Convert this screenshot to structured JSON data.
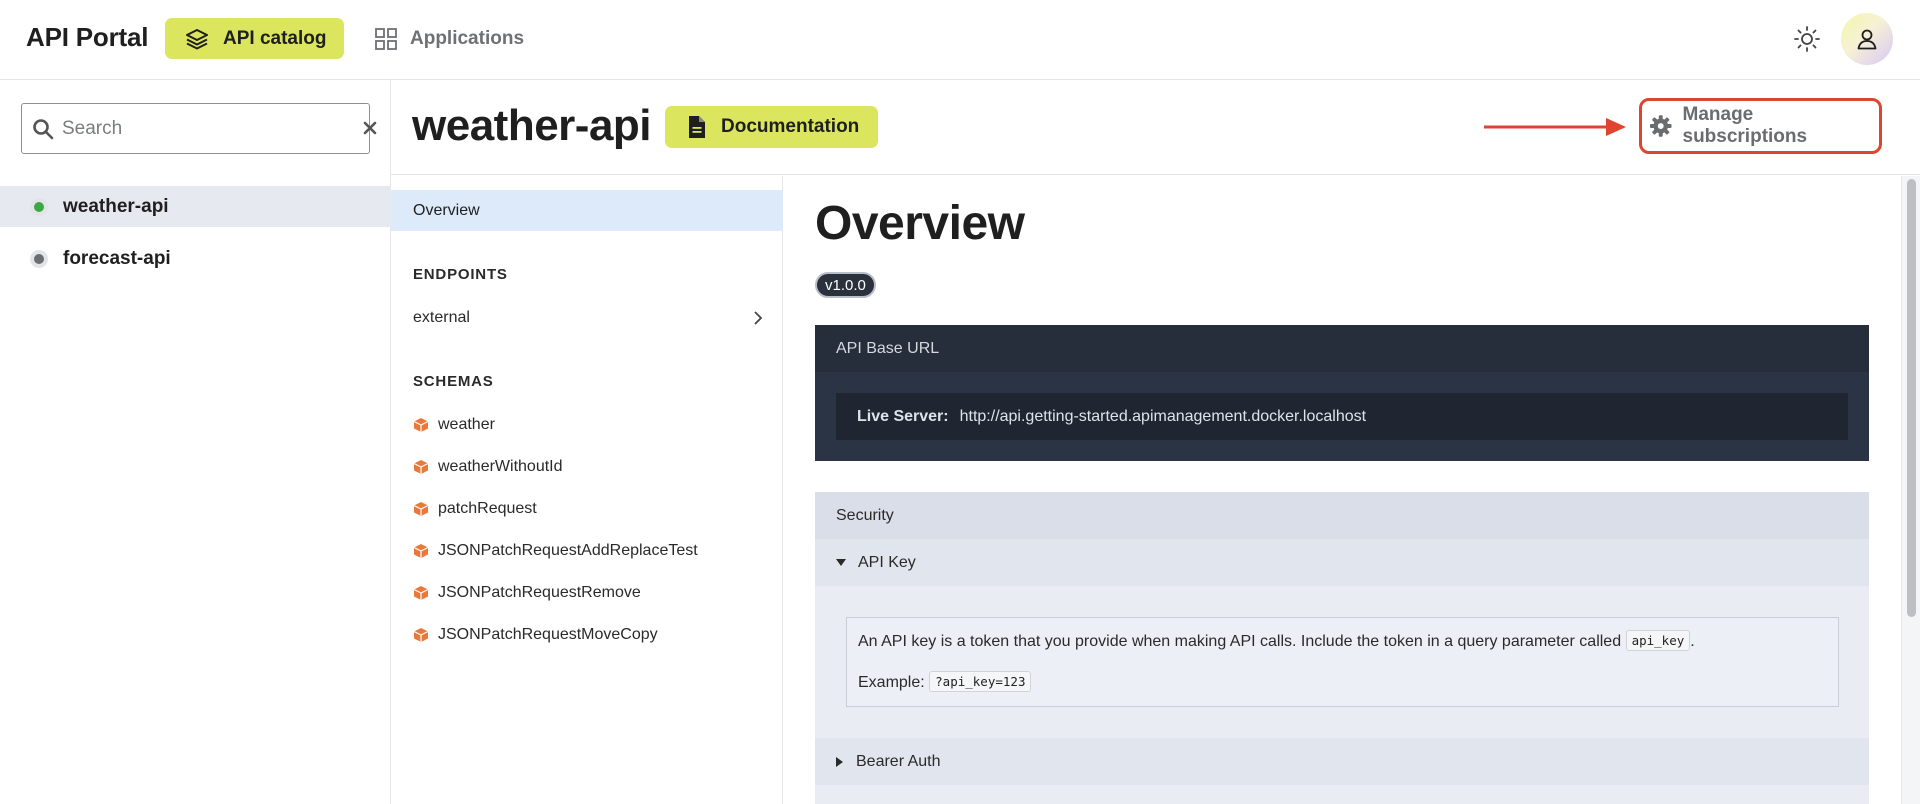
{
  "header": {
    "brand": "API Portal",
    "nav": {
      "catalog_label": "API catalog",
      "applications_label": "Applications"
    },
    "accent_color": "#dbe55d"
  },
  "sidebar": {
    "search_placeholder": "Search",
    "apis": [
      {
        "label": "weather-api",
        "status_color": "#3aa744",
        "active": true
      },
      {
        "label": "forecast-api",
        "status_color": "#6b6d72",
        "active": false
      }
    ]
  },
  "content": {
    "api_title": "weather-api",
    "documentation_label": "Documentation",
    "manage_subscriptions_label": "Manage subscriptions",
    "annotation_color": "#e0432f"
  },
  "doc_nav": {
    "overview_label": "Overview",
    "endpoints_heading": "ENDPOINTS",
    "endpoints": [
      {
        "label": "external"
      }
    ],
    "schemas_heading": "SCHEMAS",
    "schemas": [
      {
        "label": "weather"
      },
      {
        "label": "weatherWithoutId"
      },
      {
        "label": "patchRequest"
      },
      {
        "label": "JSONPatchRequestAddReplaceTest"
      },
      {
        "label": "JSONPatchRequestRemove"
      },
      {
        "label": "JSONPatchRequestMoveCopy"
      }
    ],
    "schema_icon_color": "#e8793a"
  },
  "main": {
    "title": "Overview",
    "version": "v1.0.0",
    "base_url": {
      "heading": "API Base URL",
      "server_label": "Live Server:",
      "server_url": "http://api.getting-started.apimanagement.docker.localhost"
    },
    "security": {
      "heading": "Security",
      "api_key": {
        "label": "API Key",
        "description": "An API key is a token that you provide when making API calls. Include the token in a query parameter called",
        "param": "api_key",
        "example_label": "Example:",
        "example_value": "?api_key=123"
      },
      "bearer": {
        "label": "Bearer Auth"
      }
    }
  }
}
